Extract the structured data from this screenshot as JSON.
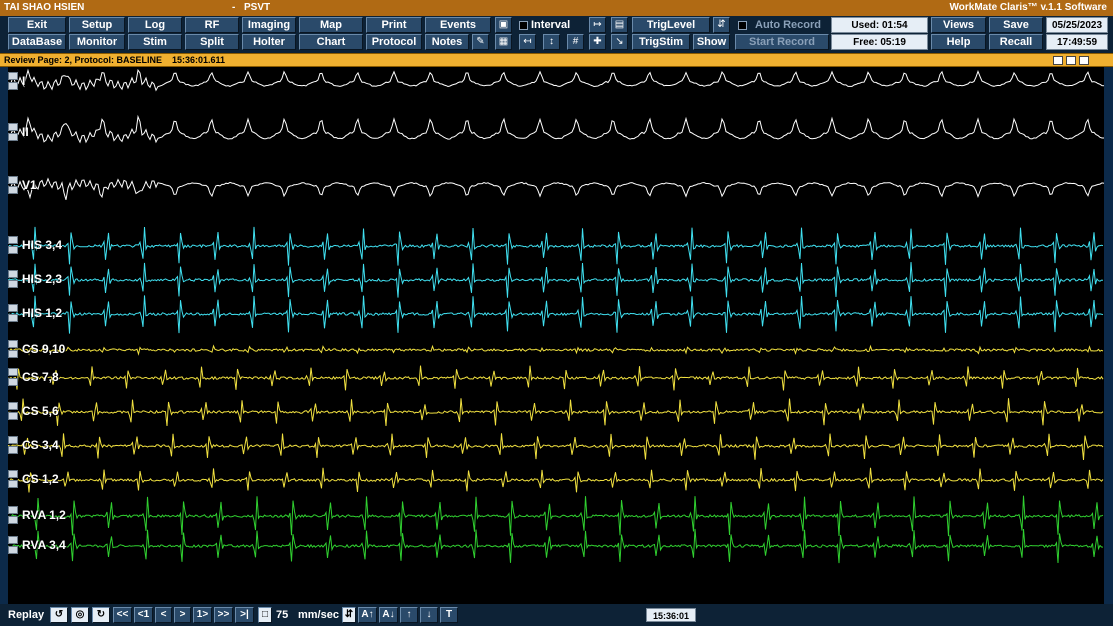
{
  "titlebar": {
    "patient": "TAI SHAO HSIEN",
    "separator": "-",
    "procedure": "PSVT",
    "software": "WorkMate Claris™ v.1.1 Software"
  },
  "toolbar": {
    "row1": [
      "Exit",
      "Setup",
      "Log",
      "RF",
      "Imaging",
      "Map",
      "Print",
      "Events"
    ],
    "row2": [
      "DataBase",
      "Monitor",
      "Stim",
      "Split",
      "Holter",
      "Chart",
      "Protocol",
      "Notes"
    ],
    "interval_label": "Interval",
    "trig_level": "TrigLevel",
    "trig_stim": "TrigStim",
    "show": "Show",
    "auto_record": "Auto Record",
    "start_record": "Start Record",
    "used": "Used: 01:54",
    "free": "Free: 05:19",
    "views": "Views",
    "save": "Save",
    "help": "Help",
    "recall": "Recall",
    "date": "05/25/2023",
    "time": "17:49:59"
  },
  "reviewbar": {
    "text": "Review Page: 2, Protocol: BASELINE",
    "time": "15:36:01.611"
  },
  "channels": [
    {
      "label": "I",
      "color": "#ffffff"
    },
    {
      "label": "II",
      "color": "#ffffff"
    },
    {
      "label": "V1",
      "color": "#ffffff"
    },
    {
      "label": "HIS 3,4",
      "color": "#40e0f0"
    },
    {
      "label": "HIS 2,3",
      "color": "#40e0f0"
    },
    {
      "label": "HIS 1,2",
      "color": "#40e0f0"
    },
    {
      "label": "CS 9,10",
      "color": "#f0e040"
    },
    {
      "label": "CS 7,8",
      "color": "#f0e040"
    },
    {
      "label": "CS 5,6",
      "color": "#f0e040"
    },
    {
      "label": "CS 3,4",
      "color": "#f0e040"
    },
    {
      "label": "CS 1,2",
      "color": "#f0e040"
    },
    {
      "label": "RVA 1,2",
      "color": "#30d030"
    },
    {
      "label": "RVA 3,4",
      "color": "#30d030"
    }
  ],
  "bottombar": {
    "replay": "Replay",
    "nav": [
      "<<",
      "<1",
      "<",
      ">",
      "1>",
      ">>",
      ">|"
    ],
    "speed": "75",
    "speed_unit": "mm/sec",
    "cursor_time": "15:36:01"
  }
}
